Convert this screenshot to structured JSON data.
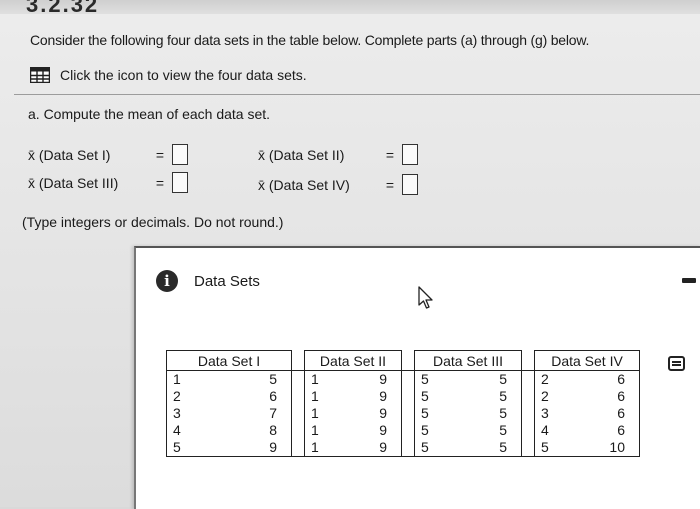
{
  "header_fragment": "3.2.32",
  "instruction": "Consider the following four data sets in the table below. Complete parts (a) through (g) below.",
  "table_link": {
    "label": "Click the icon to view the four data sets.",
    "icon": "grid-table-icon"
  },
  "part_a": {
    "prompt": "a. Compute the mean of each data set.",
    "rows": [
      {
        "label": "x̄ (Data Set I)",
        "eq": "="
      },
      {
        "label": "x̄ (Data Set II)",
        "eq": "="
      },
      {
        "label": "x̄ (Data Set III)",
        "eq": "="
      },
      {
        "label": "x̄ (Data Set IV)",
        "eq": "="
      }
    ],
    "note": "(Type integers or decimals. Do not round.)"
  },
  "popup": {
    "title": "Data Sets",
    "icon": "info-icon",
    "headers": [
      "Data Set I",
      "Data Set II",
      "Data Set III",
      "Data Set IV"
    ],
    "rows": [
      [
        "1",
        "5",
        "1",
        "9",
        "5",
        "5",
        "2",
        "6"
      ],
      [
        "2",
        "6",
        "1",
        "9",
        "5",
        "5",
        "2",
        "6"
      ],
      [
        "3",
        "7",
        "1",
        "9",
        "5",
        "5",
        "3",
        "6"
      ],
      [
        "4",
        "8",
        "1",
        "9",
        "5",
        "5",
        "4",
        "6"
      ],
      [
        "5",
        "9",
        "1",
        "9",
        "5",
        "5",
        "5",
        "10"
      ]
    ]
  }
}
